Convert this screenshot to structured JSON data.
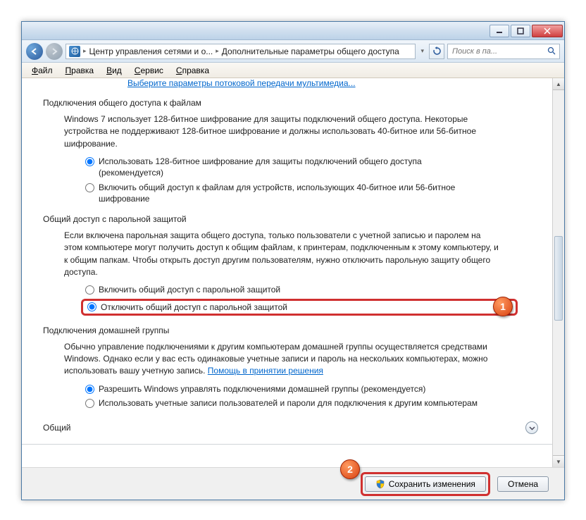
{
  "titlebar": {
    "minimize": "—",
    "maximize": "□",
    "close": "✕"
  },
  "breadcrumb": {
    "part1": "Центр управления сетями и о...",
    "part2": "Дополнительные параметры общего доступа"
  },
  "search": {
    "placeholder": "Поиск в па..."
  },
  "menu": {
    "file": "Файл",
    "edit": "Правка",
    "view": "Вид",
    "tools": "Сервис",
    "help": "Справка"
  },
  "content": {
    "cut_link": "Выберите параметры потоковой передачи мультимедиа...",
    "s1_head": "Подключения общего доступа к файлам",
    "s1_body": "Windows 7 использует 128-битное шифрование для защиты подключений общего доступа. Некоторые устройства не поддерживают 128-битное шифрование и должны использовать 40-битное или 56-битное шифрование.",
    "s1_r1": "Использовать 128-битное шифрование для защиты подключений общего доступа (рекомендуется)",
    "s1_r2": "Включить общий доступ к файлам для устройств, использующих 40-битное или 56-битное шифрование",
    "s2_head": "Общий доступ с парольной защитой",
    "s2_body": "Если включена парольная защита общего доступа, только пользователи с учетной записью и паролем на этом компьютере могут получить доступ к общим файлам, к принтерам, подключенным к этому компьютеру, и к общим папкам. Чтобы открыть доступ другим пользователям, нужно отключить парольную защиту общего доступа.",
    "s2_r1": "Включить общий доступ с парольной защитой",
    "s2_r2": "Отключить общий доступ с парольной защитой",
    "s3_head": "Подключения домашней группы",
    "s3_body": "Обычно управление подключениями к другим компьютерам домашней группы осуществляется средствами Windows. Однако если у вас есть одинаковые учетные записи и пароль на нескольких компьютерах, можно использовать вашу учетную запись. ",
    "s3_link": "Помощь в принятии решения",
    "s3_r1": "Разрешить Windows управлять подключениями домашней группы (рекомендуется)",
    "s3_r2": "Использовать учетные записи пользователей и пароли для подключения к другим компьютерам",
    "expander": "Общий"
  },
  "footer": {
    "save": "Сохранить изменения",
    "cancel": "Отмена"
  },
  "callouts": {
    "one": "1",
    "two": "2"
  }
}
